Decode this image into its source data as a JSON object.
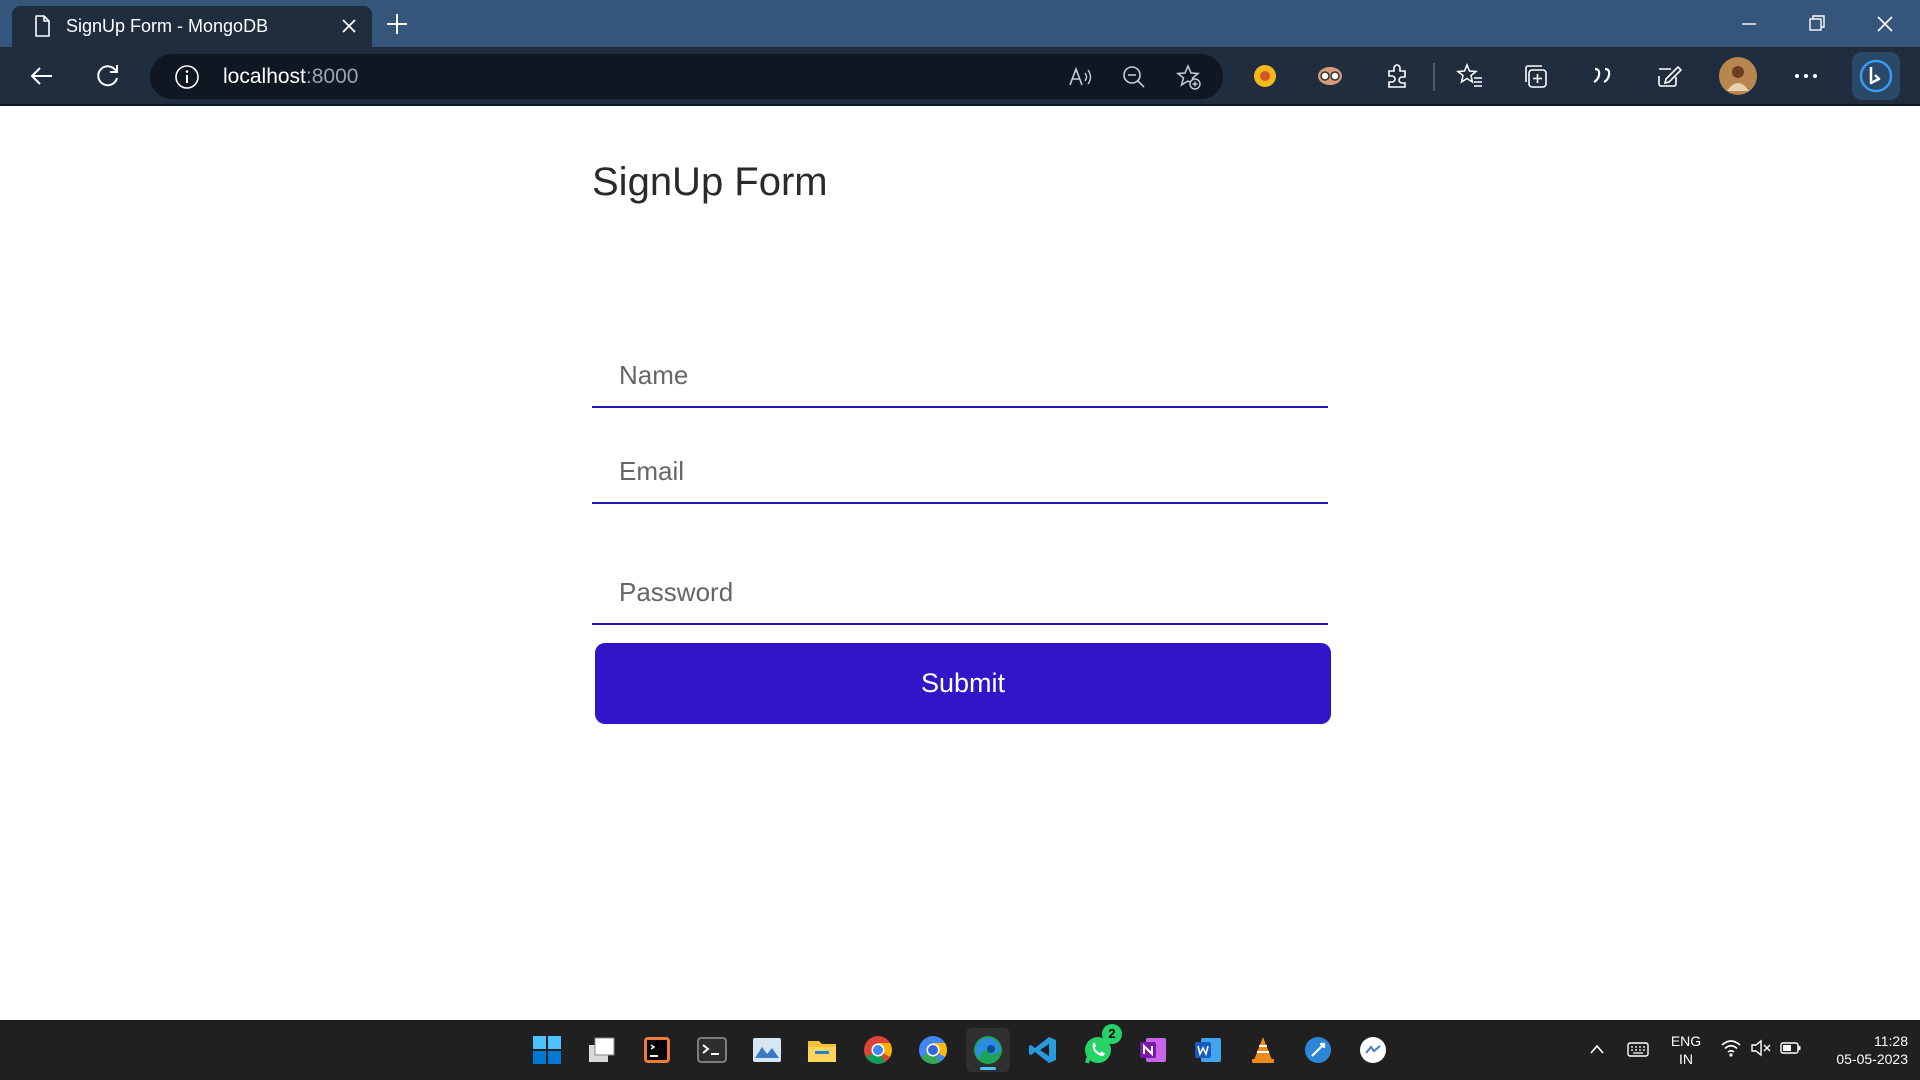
{
  "browser": {
    "tab_title": "SignUp Form - MongoDB",
    "url_host": "localhost",
    "url_port": ":8000"
  },
  "form": {
    "title": "SignUp Form",
    "name_placeholder": "Name",
    "email_placeholder": "Email",
    "password_placeholder": "Password",
    "submit_label": "Submit"
  },
  "taskbar": {
    "whatsapp_badge": "2",
    "lang_line1": "ENG",
    "lang_line2": "IN",
    "time": "11:28",
    "date": "05-05-2023"
  },
  "colors": {
    "titlebar": "#35557a",
    "toolbar": "#1f2d3f",
    "accent": "#3115c8",
    "field_underline": "#2316b8"
  }
}
